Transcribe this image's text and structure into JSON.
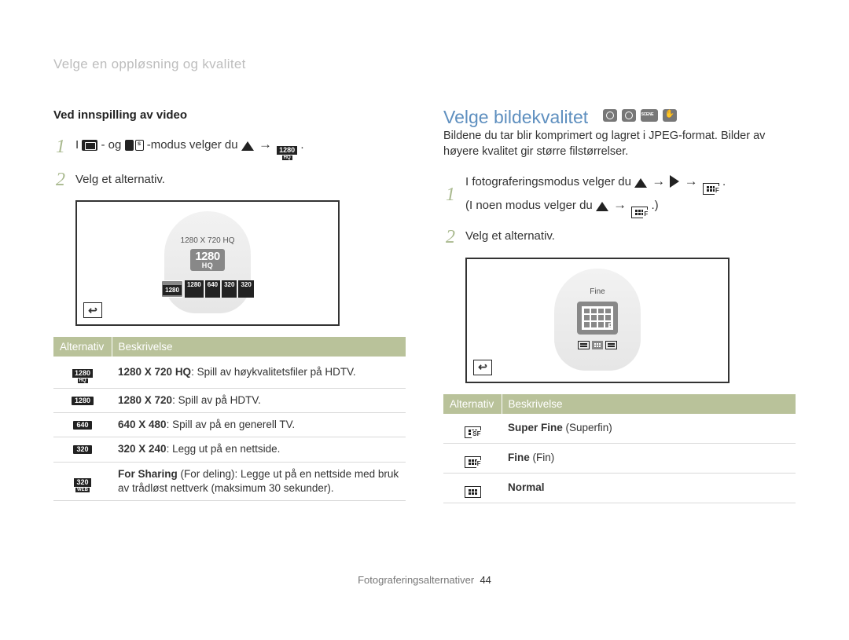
{
  "breadcrumb": "Velge en oppløsning og kvalitet",
  "left": {
    "subheading": "Ved innspilling av video",
    "step1_parts": {
      "p1": "I ",
      "p2": "- og ",
      "p3": "-modus velger du ",
      "arrow": "→",
      "end": "."
    },
    "step2": "Velg et alternativ.",
    "screen_label": "1280 X 720 HQ",
    "screen_bigchip_l1": "1280",
    "screen_bigchip_l2": "HQ",
    "chips": [
      "1280",
      "1280",
      "640",
      "320",
      "320"
    ],
    "chips_sub": [
      "HQ",
      "",
      "",
      "",
      "WEB"
    ],
    "back_symbol": "↩",
    "table_head_alt": "Alternativ",
    "table_head_desc": "Beskrivelse",
    "rows": [
      {
        "icon_top": "1280",
        "icon_sub": "HQ",
        "desc_b": "1280 X 720 HQ",
        "desc": ": Spill av høykvalitetsfiler på HDTV."
      },
      {
        "icon_top": "1280",
        "icon_sub": "",
        "desc_b": "1280 X 720",
        "desc": ": Spill av på HDTV."
      },
      {
        "icon_top": "640",
        "icon_sub": "",
        "desc_b": "640 X 480",
        "desc": ": Spill av på en generell TV."
      },
      {
        "icon_top": "320",
        "icon_sub": "",
        "desc_b": "320 X 240",
        "desc": ": Legg ut på en nettside."
      },
      {
        "icon_top": "320",
        "icon_sub": "WEB",
        "desc_b": "For Sharing",
        "desc": " (For deling): Legge ut på en nettside med bruk av trådløst nettverk (maksimum 30 sekunder)."
      }
    ]
  },
  "right": {
    "h2": "Velge bildekvalitet",
    "body": "Bildene du tar blir komprimert og lagret i JPEG-format. Bilder av høyere kvalitet gir større filstørrelser.",
    "step1_a": "I fotograferingsmodus velger du ",
    "step1_b": "(I noen modus velger du ",
    "step1_c": ".)",
    "arrow": "→",
    "end": ".",
    "step2": "Velg et alternativ.",
    "screen_label": "Fine",
    "back_symbol": "↩",
    "table_head_alt": "Alternativ",
    "table_head_desc": "Beskrivelse",
    "rows": [
      {
        "sub": "SF",
        "desc_b": "Super Fine",
        "desc": " (Superfin)"
      },
      {
        "sub": "F",
        "desc_b": "Fine",
        "desc": " (Fin)"
      },
      {
        "sub": "",
        "desc_b": "Normal",
        "desc": ""
      }
    ]
  },
  "footer": {
    "section": "Fotograferingsalternativer",
    "page": "44"
  }
}
